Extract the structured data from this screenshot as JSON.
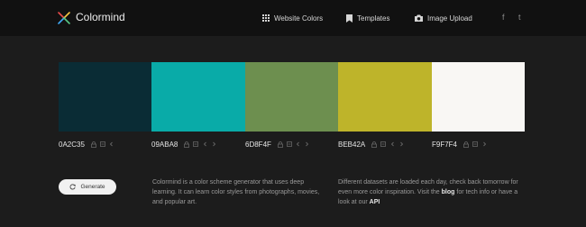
{
  "header": {
    "brand": "Colormind",
    "nav": {
      "website_colors": "Website Colors",
      "templates": "Templates",
      "image_upload": "Image Upload"
    },
    "social": {
      "facebook": "f",
      "twitter": "t"
    }
  },
  "palette": [
    {
      "hex": "0A2C35",
      "color": "#0A2C35"
    },
    {
      "hex": "09ABA8",
      "color": "#09ABA8"
    },
    {
      "hex": "6D8F4F",
      "color": "#6D8F4F"
    },
    {
      "hex": "BEB42A",
      "color": "#BEB42A"
    },
    {
      "hex": "F9F7F4",
      "color": "#F9F7F4"
    }
  ],
  "controls": {
    "generate_label": "Generate"
  },
  "about": {
    "left_text": "Colormind is a color scheme generator that uses deep learning. It can learn color styles from photographs, movies, and popular art.",
    "right_text_1": "Different datasets are loaded each day, check back tomorrow for even more color inspiration. Visit the ",
    "blog_link": "blog",
    "right_text_2": " for tech info or have a look at our ",
    "api_link": "API"
  },
  "colors": {
    "background": "#1c1c1c",
    "topbar": "#111111",
    "button": "#f1f1f1"
  }
}
